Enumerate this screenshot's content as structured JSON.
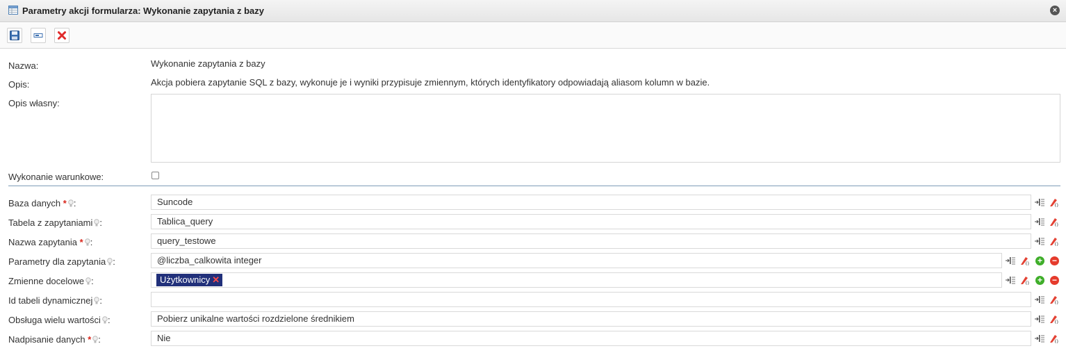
{
  "window": {
    "title": "Parametry akcji formularza: Wykonanie zapytania z bazy",
    "close_glyph": "×"
  },
  "toolbar": {
    "buttons": [
      {
        "name": "save-button",
        "icon": "floppy-disk-icon"
      },
      {
        "name": "rename-button",
        "icon": "text-field-icon"
      },
      {
        "name": "delete-button",
        "icon": "red-x-icon"
      }
    ]
  },
  "info": {
    "name_label": "Nazwa:",
    "name_value": "Wykonanie zapytania z bazy",
    "desc_label": "Opis:",
    "desc_value": "Akcja pobiera zapytanie SQL z bazy, wykonuje je i wyniki przypisuje zmiennym, których identyfikatory odpowiadają aliasom kolumn w bazie.",
    "own_desc_label": "Opis własny:",
    "own_desc_value": "",
    "conditional_label": "Wykonanie warunkowe:",
    "conditional_checked": false
  },
  "params": [
    {
      "label": "Baza danych",
      "required": true,
      "value": "Suncode"
    },
    {
      "label": "Tabela z zapytaniami",
      "required": false,
      "value": "Tablica_query"
    },
    {
      "label": "Nazwa zapytania",
      "required": true,
      "value": "query_testowe"
    },
    {
      "label": "Parametry dla zapytania",
      "required": false,
      "value": "@liczba_calkowita integer"
    },
    {
      "label": "Zmienne docelowe",
      "required": false,
      "tag": "Użytkownicy",
      "tag_remove": "✕"
    },
    {
      "label": "Id tabeli dynamicznej",
      "required": false,
      "value": ""
    },
    {
      "label": "Obsługa wielu wartości",
      "required": false,
      "value": "Pobierz unikalne wartości rozdzielone średnikiem"
    },
    {
      "label": "Nadpisanie danych",
      "required": true,
      "value": "Nie"
    }
  ],
  "symbols": {
    "required_mark": "*",
    "colon": ":",
    "add": "+",
    "remove": "−"
  },
  "colors": {
    "required": "#d9261c",
    "tag_bg": "#21307a",
    "separator": "#7d9cb8",
    "add": "#3fae2a",
    "remove": "#e53b2c"
  }
}
